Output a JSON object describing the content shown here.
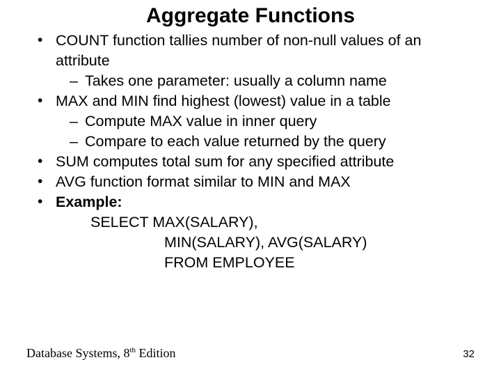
{
  "title": "Aggregate Functions",
  "bullets": {
    "b1": "COUNT function tallies number of non-null values of an attribute",
    "b1s1": "Takes one parameter: usually a column name",
    "b2": "MAX and MIN find highest (lowest) value in a table",
    "b2s1": "Compute MAX value in inner query",
    "b2s2": "Compare to each value returned by the query",
    "b3": "SUM computes total sum for any specified attribute",
    "b4": "AVG function format similar to MIN and MAX",
    "b5": "Example:"
  },
  "code": {
    "l1": "SELECT   MAX(SALARY),",
    "l2": "MIN(SALARY), AVG(SALARY)",
    "l3": "FROM EMPLOYEE"
  },
  "footer": {
    "left_a": "Database Systems, 8",
    "left_sup": "th",
    "left_b": " Edition",
    "page": "32"
  }
}
